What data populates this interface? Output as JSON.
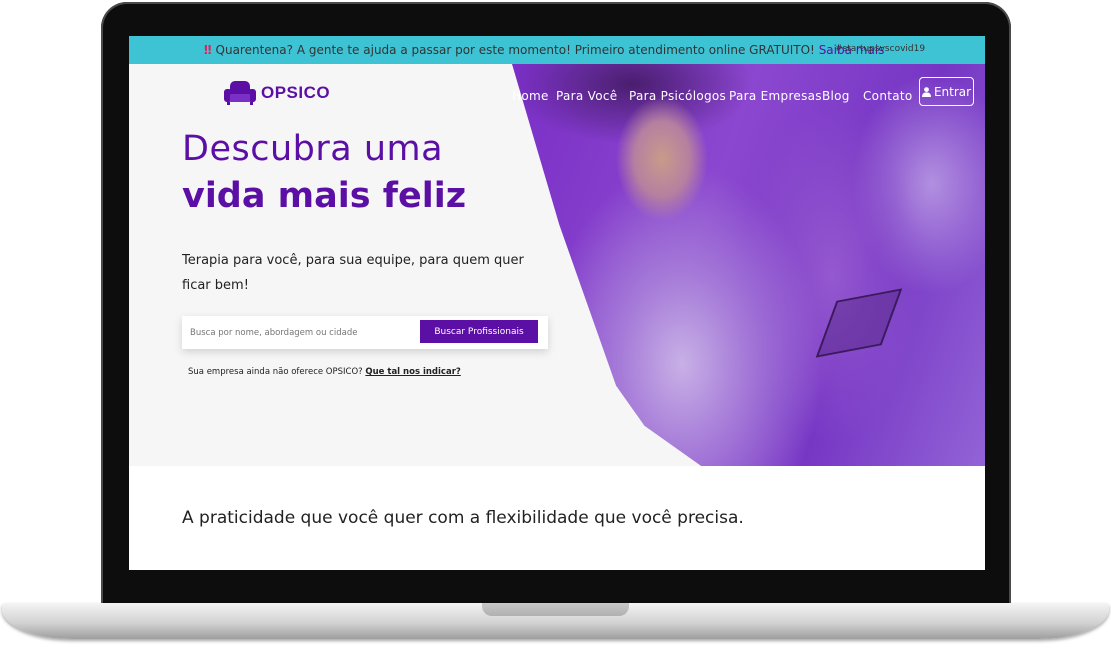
{
  "banner": {
    "warning_glyph": "‼",
    "message": "Quarentena? A gente te ajuda a passar por este momento! Primeiro atendimento online GRATUITO!",
    "link_label": "Saiba mais",
    "hashtag": "#startupsvscovid19"
  },
  "brand": {
    "name": "OPSICO",
    "icon": "armchair-icon",
    "color": "#5b0fa5"
  },
  "nav": {
    "items": [
      "Home",
      "Para Você",
      "Para Psicólogos",
      "Para Empresas",
      "Blog",
      "Contato"
    ],
    "login_label": "Entrar",
    "login_icon": "user-icon"
  },
  "hero": {
    "title_line1": "Descubra uma",
    "title_line2": "vida mais feliz",
    "subtitle": "Terapia para você, para sua equipe, para quem quer ficar bem!",
    "search_placeholder": "Busca por nome, abordagem ou cidade",
    "search_button": "Buscar Profissionais",
    "refer_text": "Sua empresa ainda não oferece OPSICO?",
    "refer_link": "Que tal nos indicar?"
  },
  "section": {
    "tagline": "A praticidade que você quer com a flexibilidade que você precisa."
  },
  "colors": {
    "banner_bg": "#3ec3d5",
    "primary": "#5b0fa5",
    "hero_overlay": "#7a2fc6"
  }
}
